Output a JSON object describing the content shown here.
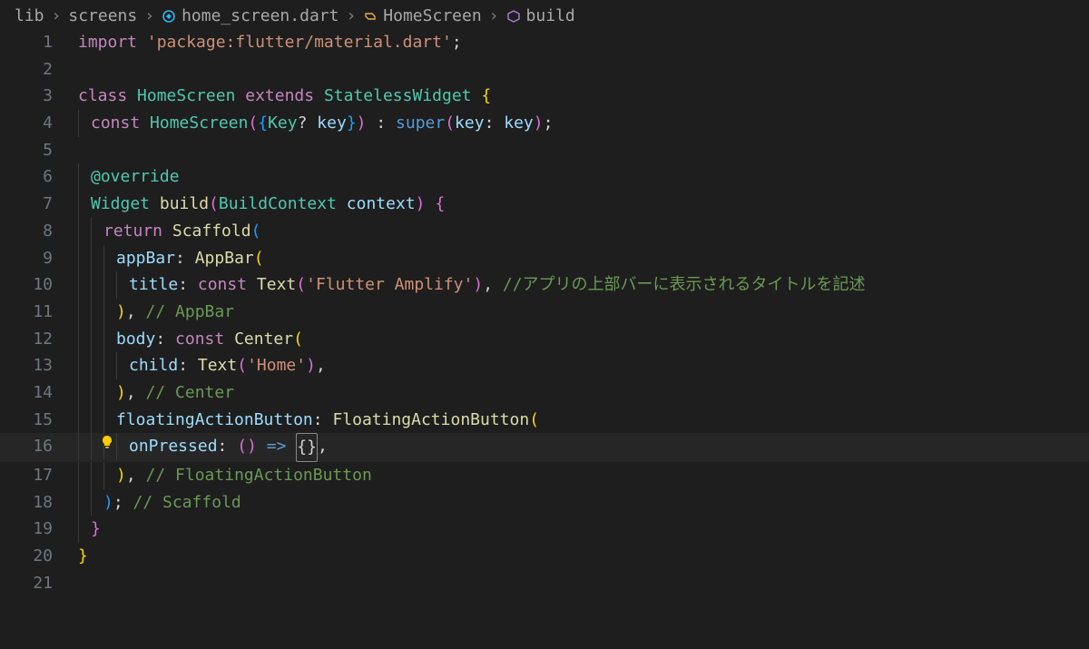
{
  "breadcrumb": {
    "items": [
      {
        "label": "lib",
        "icon": null
      },
      {
        "label": "screens",
        "icon": null
      },
      {
        "label": "home_screen.dart",
        "icon": "dart-file-icon"
      },
      {
        "label": "HomeScreen",
        "icon": "class-icon"
      },
      {
        "label": "build",
        "icon": "method-icon"
      }
    ],
    "separator": "›"
  },
  "editor": {
    "current_line": 16,
    "lightbulb_line": 16,
    "lines": [
      {
        "n": 1,
        "indent": 0,
        "tokens": [
          {
            "t": "import ",
            "c": "tk-kw"
          },
          {
            "t": "'package:flutter/material.dart'",
            "c": "tk-str"
          },
          {
            "t": ";",
            "c": "tk-pun"
          }
        ]
      },
      {
        "n": 2,
        "indent": 0,
        "tokens": []
      },
      {
        "n": 3,
        "indent": 0,
        "tokens": [
          {
            "t": "class ",
            "c": "tk-kw"
          },
          {
            "t": "HomeScreen ",
            "c": "tk-type"
          },
          {
            "t": "extends ",
            "c": "tk-kw"
          },
          {
            "t": "StatelessWidget ",
            "c": "tk-type"
          },
          {
            "t": "{",
            "c": "tk-brY"
          }
        ]
      },
      {
        "n": 4,
        "indent": 1,
        "tokens": [
          {
            "t": "const ",
            "c": "tk-kw"
          },
          {
            "t": "HomeScreen",
            "c": "tk-type"
          },
          {
            "t": "(",
            "c": "tk-brP"
          },
          {
            "t": "{",
            "c": "tk-brB"
          },
          {
            "t": "Key",
            "c": "tk-type"
          },
          {
            "t": "? ",
            "c": "tk-pun"
          },
          {
            "t": "key",
            "c": "tk-id"
          },
          {
            "t": "}",
            "c": "tk-brB"
          },
          {
            "t": ")",
            "c": "tk-brP"
          },
          {
            "t": " : ",
            "c": "tk-pun"
          },
          {
            "t": "super",
            "c": "tk-key"
          },
          {
            "t": "(",
            "c": "tk-brP"
          },
          {
            "t": "key",
            "c": "tk-id"
          },
          {
            "t": ": ",
            "c": "tk-pun"
          },
          {
            "t": "key",
            "c": "tk-id"
          },
          {
            "t": ")",
            "c": "tk-brP"
          },
          {
            "t": ";",
            "c": "tk-pun"
          }
        ]
      },
      {
        "n": 5,
        "indent": 0,
        "tokens": []
      },
      {
        "n": 6,
        "indent": 1,
        "tokens": [
          {
            "t": "@override",
            "c": "tk-at"
          }
        ]
      },
      {
        "n": 7,
        "indent": 1,
        "tokens": [
          {
            "t": "Widget ",
            "c": "tk-type"
          },
          {
            "t": "build",
            "c": "tk-fn"
          },
          {
            "t": "(",
            "c": "tk-brP"
          },
          {
            "t": "BuildContext ",
            "c": "tk-type"
          },
          {
            "t": "context",
            "c": "tk-id"
          },
          {
            "t": ")",
            "c": "tk-brP"
          },
          {
            "t": " {",
            "c": "tk-brP"
          }
        ]
      },
      {
        "n": 8,
        "indent": 2,
        "tokens": [
          {
            "t": "return ",
            "c": "tk-kw"
          },
          {
            "t": "Scaffold",
            "c": "tk-fn"
          },
          {
            "t": "(",
            "c": "tk-brB"
          }
        ]
      },
      {
        "n": 9,
        "indent": 3,
        "tokens": [
          {
            "t": "appBar",
            "c": "tk-id"
          },
          {
            "t": ": ",
            "c": "tk-pun"
          },
          {
            "t": "AppBar",
            "c": "tk-fn"
          },
          {
            "t": "(",
            "c": "tk-brY"
          }
        ]
      },
      {
        "n": 10,
        "indent": 4,
        "tokens": [
          {
            "t": "title",
            "c": "tk-id"
          },
          {
            "t": ": ",
            "c": "tk-pun"
          },
          {
            "t": "const ",
            "c": "tk-kw"
          },
          {
            "t": "Text",
            "c": "tk-fn"
          },
          {
            "t": "(",
            "c": "tk-brP"
          },
          {
            "t": "'Flutter Amplify'",
            "c": "tk-str"
          },
          {
            "t": ")",
            "c": "tk-brP"
          },
          {
            "t": ", ",
            "c": "tk-pun"
          },
          {
            "t": "//アプリの上部バーに表示されるタイトルを記述",
            "c": "tk-cmt"
          }
        ]
      },
      {
        "n": 11,
        "indent": 3,
        "tokens": [
          {
            "t": ")",
            "c": "tk-brY"
          },
          {
            "t": ", ",
            "c": "tk-pun"
          },
          {
            "t": "// AppBar",
            "c": "tk-cmt"
          }
        ]
      },
      {
        "n": 12,
        "indent": 3,
        "tokens": [
          {
            "t": "body",
            "c": "tk-id"
          },
          {
            "t": ": ",
            "c": "tk-pun"
          },
          {
            "t": "const ",
            "c": "tk-kw"
          },
          {
            "t": "Center",
            "c": "tk-fn"
          },
          {
            "t": "(",
            "c": "tk-brY"
          }
        ]
      },
      {
        "n": 13,
        "indent": 4,
        "tokens": [
          {
            "t": "child",
            "c": "tk-id"
          },
          {
            "t": ": ",
            "c": "tk-pun"
          },
          {
            "t": "Text",
            "c": "tk-fn"
          },
          {
            "t": "(",
            "c": "tk-brP"
          },
          {
            "t": "'Home'",
            "c": "tk-str"
          },
          {
            "t": ")",
            "c": "tk-brP"
          },
          {
            "t": ",",
            "c": "tk-pun"
          }
        ]
      },
      {
        "n": 14,
        "indent": 3,
        "tokens": [
          {
            "t": ")",
            "c": "tk-brY"
          },
          {
            "t": ", ",
            "c": "tk-pun"
          },
          {
            "t": "// Center",
            "c": "tk-cmt"
          }
        ]
      },
      {
        "n": 15,
        "indent": 3,
        "tokens": [
          {
            "t": "floatingActionButton",
            "c": "tk-id"
          },
          {
            "t": ": ",
            "c": "tk-pun"
          },
          {
            "t": "FloatingActionButton",
            "c": "tk-fn"
          },
          {
            "t": "(",
            "c": "tk-brY"
          }
        ]
      },
      {
        "n": 16,
        "indent": 4,
        "tokens": [
          {
            "t": "onPressed",
            "c": "tk-id"
          },
          {
            "t": ": ",
            "c": "tk-pun"
          },
          {
            "t": "()",
            "c": "tk-brP"
          },
          {
            "t": " => ",
            "c": "tk-key"
          },
          {
            "t": "{}",
            "c": "tk-box"
          },
          {
            "t": ",",
            "c": "tk-pun"
          }
        ]
      },
      {
        "n": 17,
        "indent": 3,
        "tokens": [
          {
            "t": ")",
            "c": "tk-brY"
          },
          {
            "t": ", ",
            "c": "tk-pun"
          },
          {
            "t": "// FloatingActionButton",
            "c": "tk-cmt"
          }
        ]
      },
      {
        "n": 18,
        "indent": 2,
        "tokens": [
          {
            "t": ")",
            "c": "tk-brB"
          },
          {
            "t": "; ",
            "c": "tk-pun"
          },
          {
            "t": "// Scaffold",
            "c": "tk-cmt"
          }
        ]
      },
      {
        "n": 19,
        "indent": 1,
        "tokens": [
          {
            "t": "}",
            "c": "tk-brP"
          }
        ]
      },
      {
        "n": 20,
        "indent": 0,
        "tokens": [
          {
            "t": "}",
            "c": "tk-brY"
          }
        ]
      },
      {
        "n": 21,
        "indent": 0,
        "tokens": []
      }
    ]
  }
}
